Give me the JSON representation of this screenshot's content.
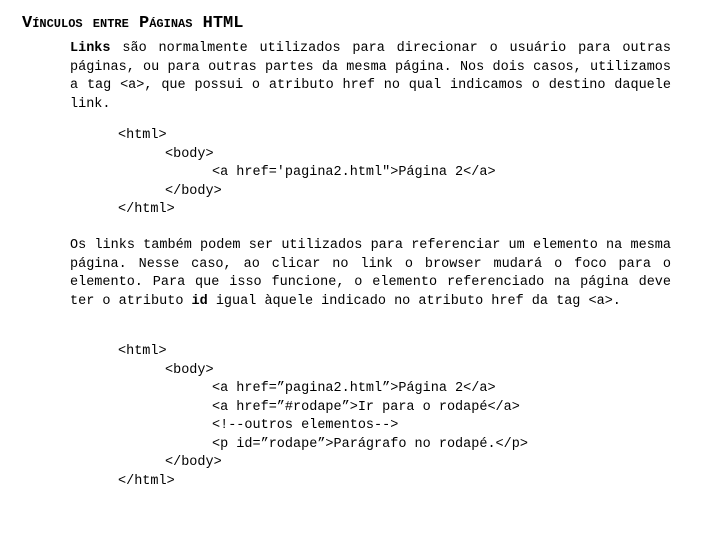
{
  "title": "Vínculos entre Páginas HTML",
  "para1": {
    "bold_lead": "Links",
    "text": " são normalmente utilizados para direcionar o usuário para outras páginas, ou para outras partes da mesma página. Nos dois casos, utilizamos a tag <a>, que possui o atributo href no qual indicamos o destino daquele link."
  },
  "code1": [
    "<html>",
    "<body>",
    "<a href='pagina2.html\">Página 2</a>",
    "</body>",
    "</html>"
  ],
  "para2": {
    "text_before": "Os links também podem ser utilizados para referenciar um elemento na mesma página. Nesse caso, ao clicar no link o browser mudará o foco para o elemento. Para que isso funcione, o elemento referenciado na página deve ter o atributo ",
    "bold_word": "id",
    "text_after": " igual àquele indicado no atributo href da tag <a>."
  },
  "code2": [
    "<html>",
    "<body>",
    "<a href=”pagina2.html”>Página 2</a>",
    "<a href=”#rodape”>Ir para o rodapé</a>",
    "<!--outros elementos-->",
    "<p id=”rodape”>Parágrafo no rodapé.</p>",
    "</body>",
    "</html>"
  ]
}
